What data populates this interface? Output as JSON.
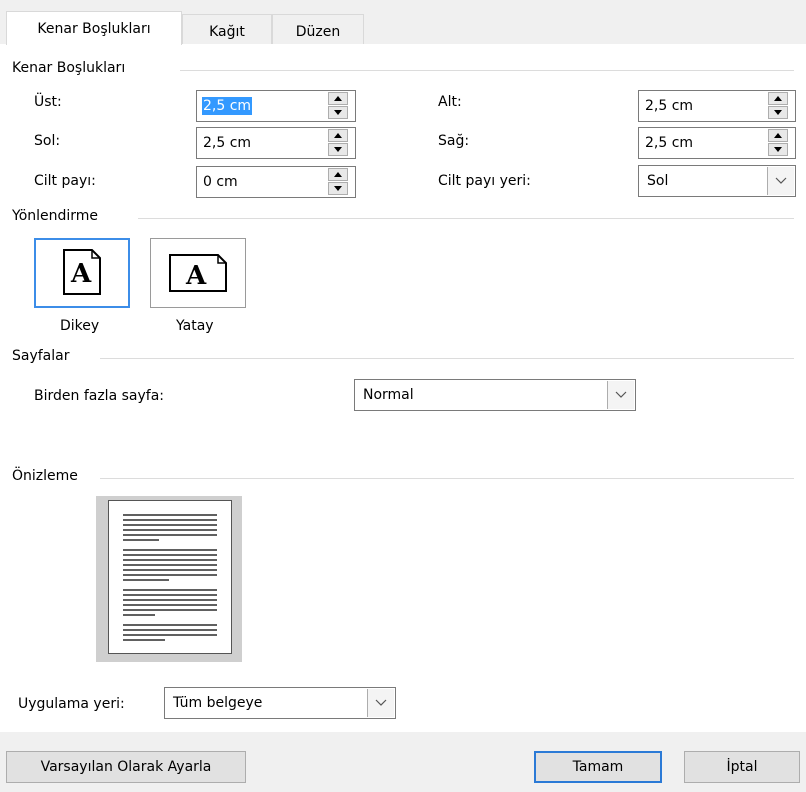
{
  "tabs": [
    {
      "label": "Kenar Boşlukları",
      "active": true
    },
    {
      "label": "Kağıt",
      "active": false
    },
    {
      "label": "Düzen",
      "active": false
    }
  ],
  "margins": {
    "title": "Kenar Boşlukları",
    "top_label": "Üst:",
    "top_value": "2,5 cm",
    "bottom_label": "Alt:",
    "bottom_value": "2,5 cm",
    "left_label": "Sol:",
    "left_value": "2,5 cm",
    "right_label": "Sağ:",
    "right_value": "2,5 cm",
    "gutter_label": "Cilt payı:",
    "gutter_value": "0 cm",
    "gutter_pos_label": "Cilt payı yeri:",
    "gutter_pos_value": "Sol"
  },
  "orientation": {
    "title": "Yönlendirme",
    "portrait_label": "Dikey",
    "landscape_label": "Yatay",
    "selected": "portrait"
  },
  "pages": {
    "title": "Sayfalar",
    "multiple_label": "Birden fazla sayfa:",
    "multiple_value": "Normal"
  },
  "preview": {
    "title": "Önizleme"
  },
  "apply": {
    "label": "Uygulama yeri:",
    "value": "Tüm belgeye"
  },
  "buttons": {
    "set_default": "Varsayılan Olarak Ayarla",
    "ok": "Tamam",
    "cancel": "İptal"
  },
  "colors": {
    "accent": "#3399ff",
    "selected_border": "#3c8de8",
    "default_button_border": "#2b7ad6"
  }
}
